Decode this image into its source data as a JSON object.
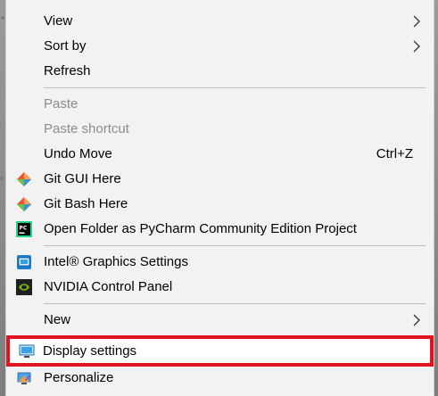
{
  "menu": {
    "items": [
      {
        "label": "View",
        "submenu": true
      },
      {
        "label": "Sort by",
        "submenu": true
      },
      {
        "label": "Refresh"
      },
      {
        "label": "Paste",
        "disabled": true
      },
      {
        "label": "Paste shortcut",
        "disabled": true
      },
      {
        "label": "Undo Move",
        "shortcut": "Ctrl+Z"
      },
      {
        "label": "Git GUI Here",
        "icon": "git-gui-icon"
      },
      {
        "label": "Git Bash Here",
        "icon": "git-bash-icon"
      },
      {
        "label": "Open Folder as PyCharm Community Edition Project",
        "icon": "pycharm-icon"
      },
      {
        "label": "Intel® Graphics Settings",
        "icon": "intel-graphics-icon"
      },
      {
        "label": "NVIDIA Control Panel",
        "icon": "nvidia-icon"
      },
      {
        "label": "New",
        "submenu": true
      },
      {
        "label": "Display settings",
        "icon": "display-icon",
        "highlighted": true
      },
      {
        "label": "Personalize",
        "icon": "personalize-icon"
      }
    ]
  },
  "colors": {
    "menu_bg": "#f2f2f2",
    "highlight_border": "#e0131f",
    "disabled_text": "#8c8c8c",
    "separator": "#bdbdbd"
  }
}
